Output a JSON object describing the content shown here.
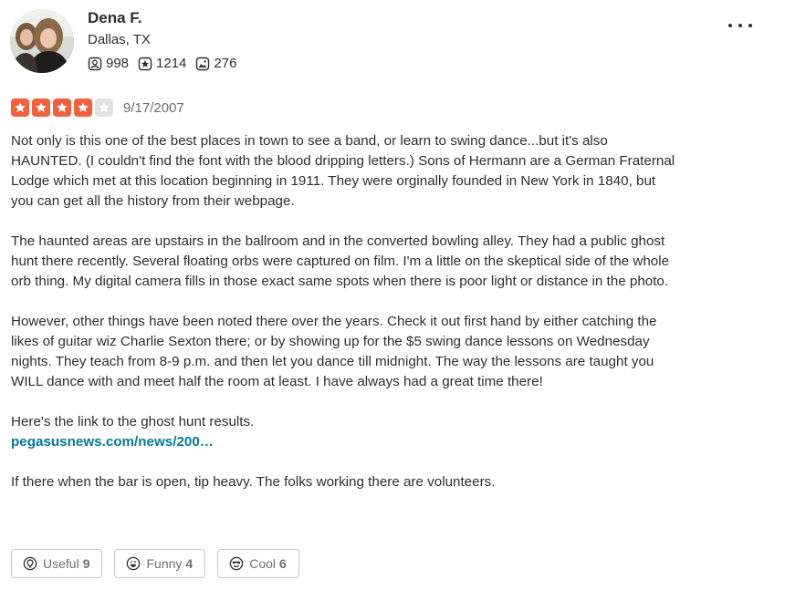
{
  "user": {
    "name": "Dena F.",
    "location": "Dallas, TX",
    "avatar_alt": "Dena F.",
    "stats": {
      "friends": "998",
      "reviews": "1214",
      "photos": "276"
    }
  },
  "review": {
    "rating": 4,
    "max_rating": 5,
    "date": "9/17/2007",
    "paragraphs": [
      "Not only is this one of the best places in town to see a band, or learn to swing dance...but it's also HAUNTED.  (I couldn't find the font with the blood dripping letters.)  Sons of Hermann are a German Fraternal Lodge which met at this location beginning in 1911.  They were orginally founded in New York in 1840, but you can get all the history from their webpage.",
      "The haunted areas are upstairs in the ballroom and in the converted bowling alley.  They had a public ghost hunt there recently.  Several floating orbs were captured on film.  I'm a little on the skeptical side of the whole orb thing.  My digital camera fills in those exact same spots when there is poor light or distance in the photo.",
      "However, other things have been noted there over the years.  Check it out first hand by either catching the likes of guitar wiz Charlie Sexton there; or by showing up for the $5 swing dance lessons on Wednesday nights.  They teach from 8-9 p.m. and then let you dance till midnight.  The way the lessons are taught you WILL dance with and meet half the room at least.  I have always had a great time there!",
      "Here's the link to the ghost hunt results.",
      "If there when the bar is open, tip heavy.  The folks working there are volunteers."
    ],
    "link_text": "pegasusnews.com/news/200…"
  },
  "reactions": {
    "useful": {
      "label": "Useful",
      "count": "9"
    },
    "funny": {
      "label": "Funny",
      "count": "4"
    },
    "cool": {
      "label": "Cool",
      "count": "6"
    }
  },
  "colors": {
    "star_filled": "#f2613d",
    "star_empty": "#e2e2e3",
    "link": "#027a97",
    "text": "#2d2e2f",
    "muted": "#6e7072",
    "border": "#c8c9ca"
  },
  "icons": {
    "friends": "friends-icon",
    "reviews": "review-star-icon",
    "photos": "photo-icon",
    "more": "more-options-icon",
    "useful": "lightbulb-icon",
    "funny": "laugh-face-icon",
    "cool": "sunglasses-face-icon"
  }
}
